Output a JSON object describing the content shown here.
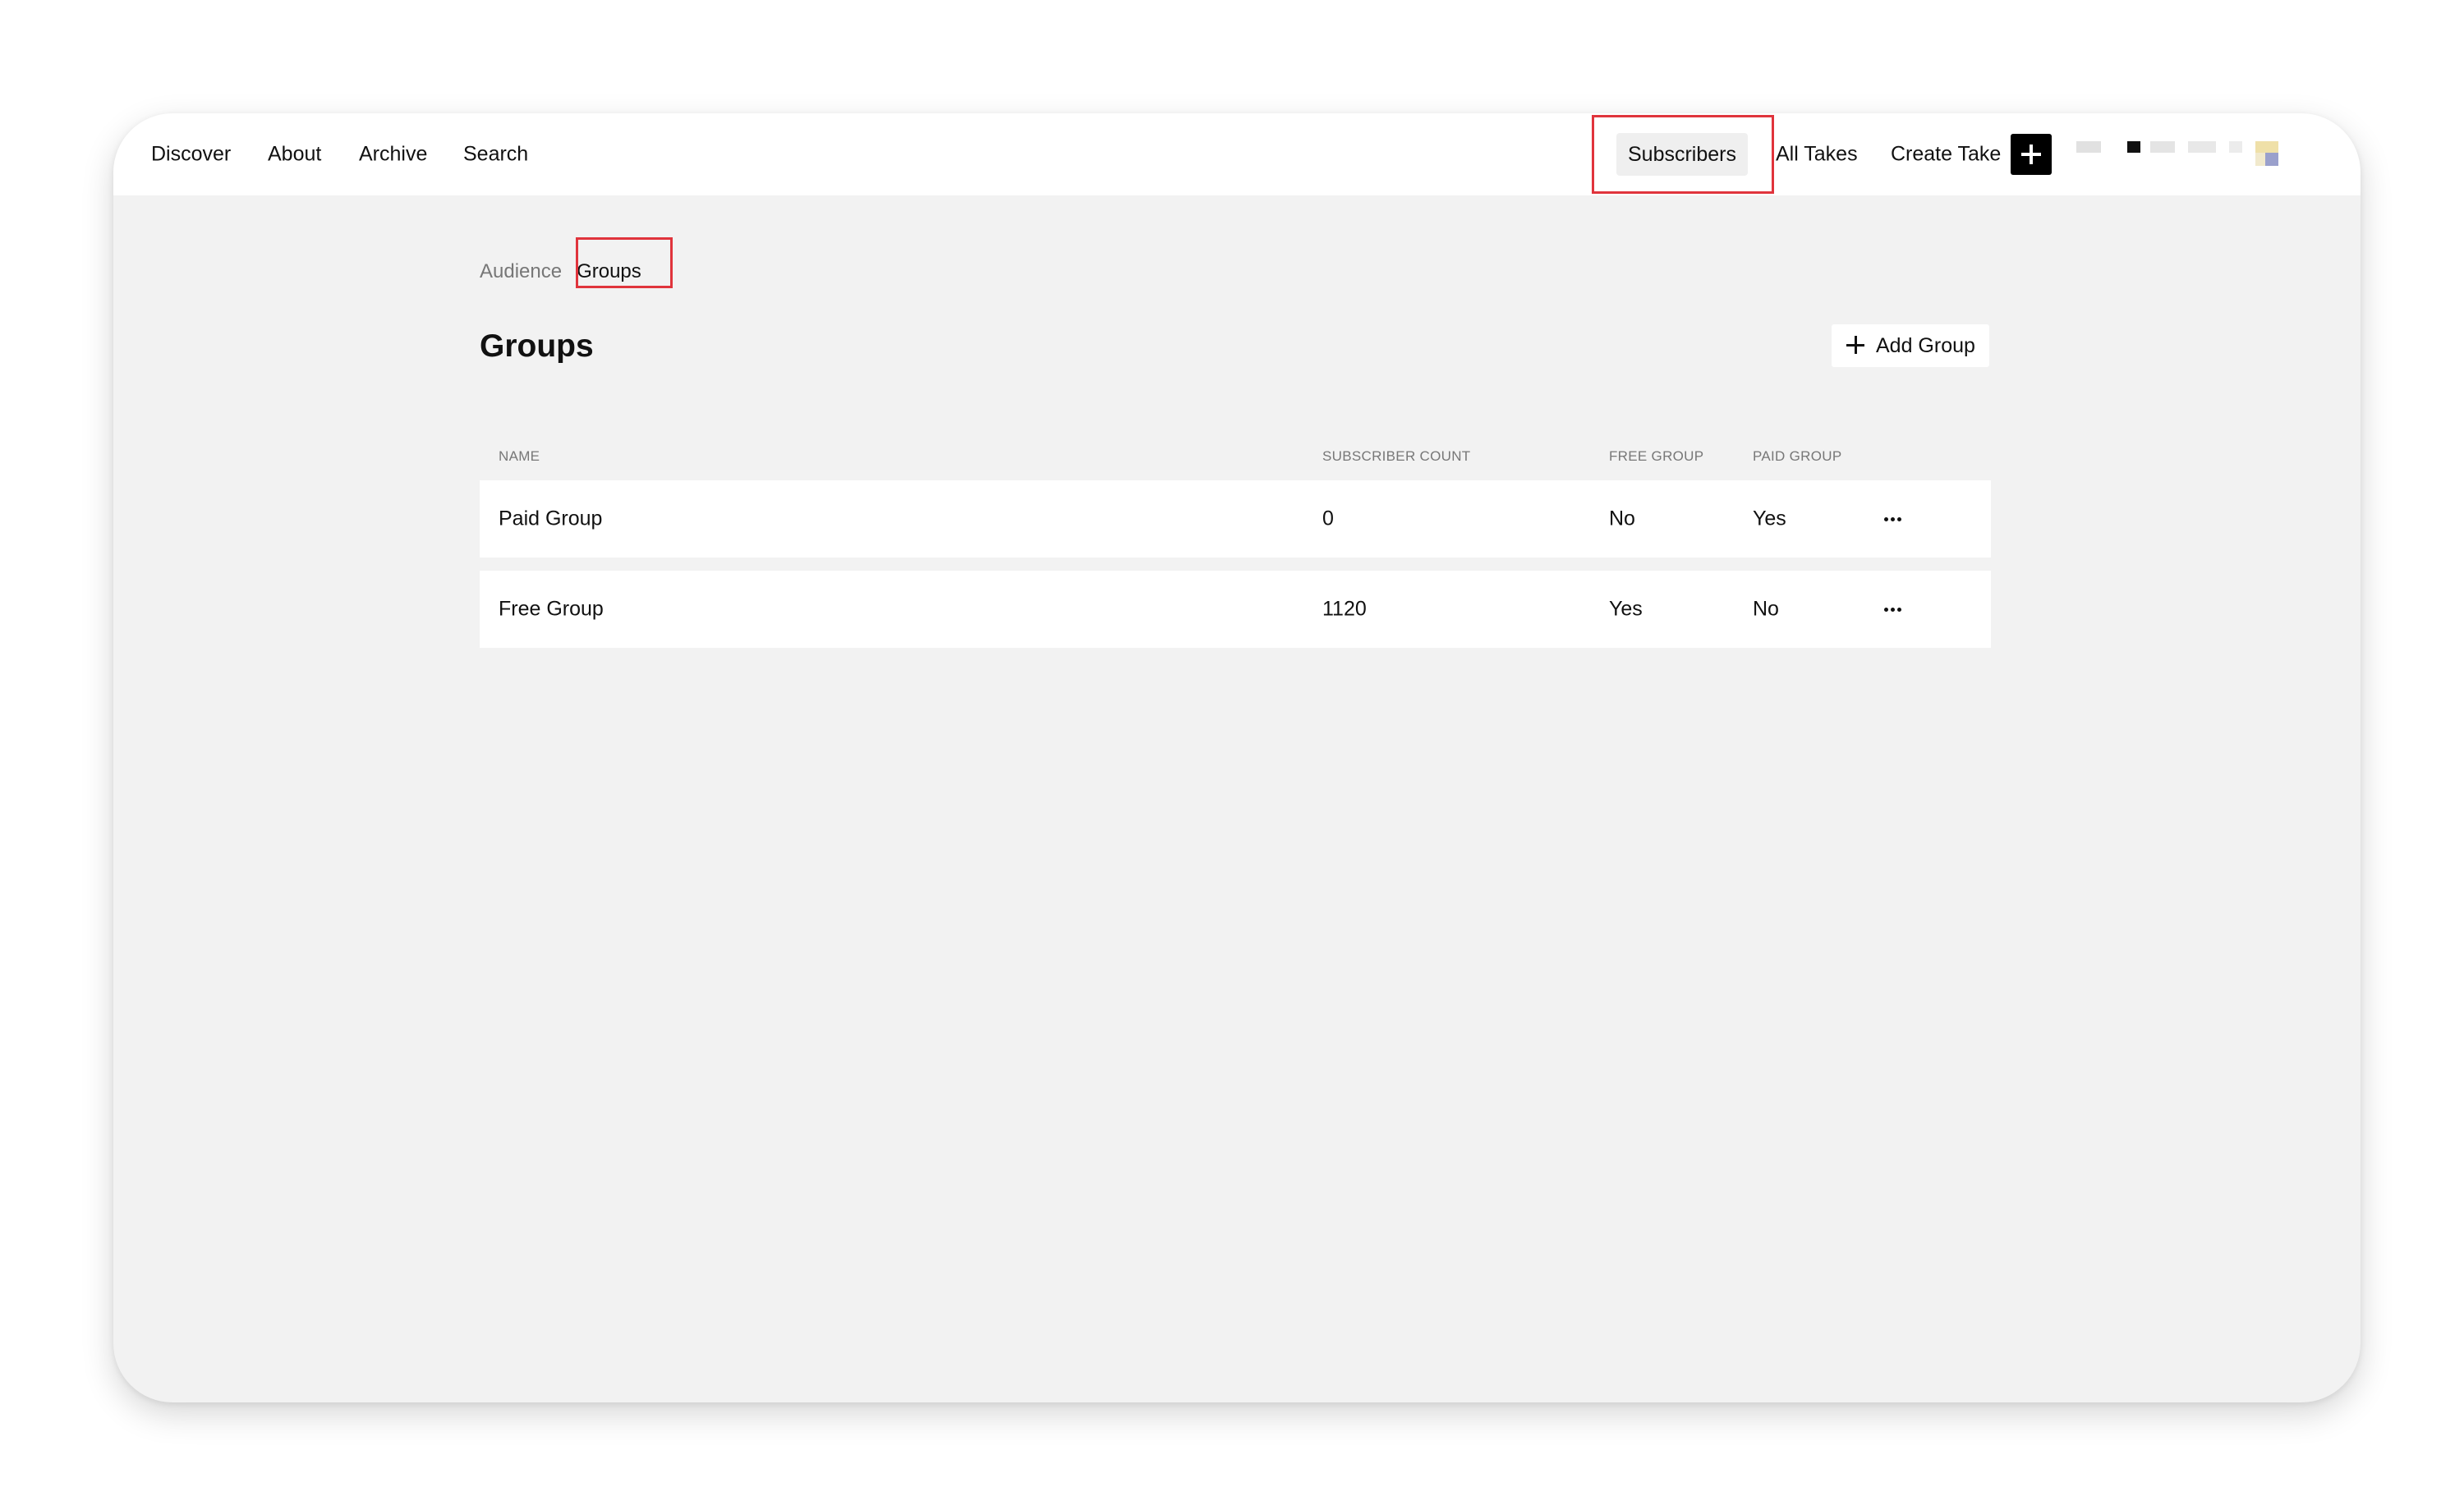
{
  "nav": {
    "left_items": [
      "Discover",
      "About",
      "Archive",
      "Search"
    ],
    "subscribers": "Subscribers",
    "all_takes": "All Takes",
    "create_take": "Create Take"
  },
  "breadcrumb": {
    "parent": "Audience",
    "current": "Groups"
  },
  "page": {
    "title": "Groups",
    "add_button_label": "Add Group"
  },
  "table": {
    "columns": [
      "NAME",
      "SUBSCRIBER COUNT",
      "FREE GROUP",
      "PAID GROUP"
    ],
    "rows": [
      {
        "name": "Paid Group",
        "subscriber_count": "0",
        "free_group": "No",
        "paid_group": "Yes"
      },
      {
        "name": "Free Group",
        "subscriber_count": "1120",
        "free_group": "Yes",
        "paid_group": "No"
      }
    ]
  },
  "colors": {
    "highlight": "#e0343c",
    "background": "#f2f2f2",
    "surface": "#ffffff",
    "accent": "#000000"
  },
  "icons": {
    "create_take": "plus-icon",
    "add_group": "plus-icon",
    "row_actions": "more-horizontal-icon"
  }
}
